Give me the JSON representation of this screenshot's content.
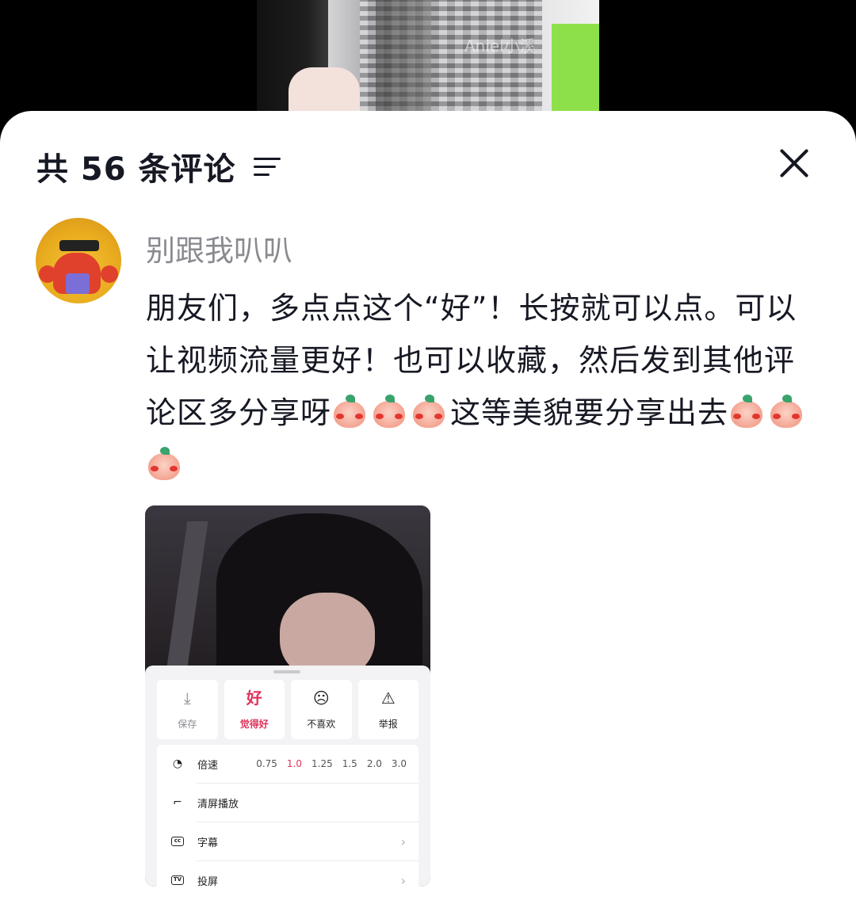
{
  "video": {
    "watermark": "Aniel小溪"
  },
  "header": {
    "title": "共 56 条评论"
  },
  "comment": {
    "username": "别跟我叭叭",
    "text_1": "朋友们，多点点这个“好”！长按就可以点。可以让视频流量更好！也可以收藏，然后发到其他评论区多分享呀",
    "text_2": "这等美貌要分享出去",
    "emoji_name": "blushing-peach-emoji"
  },
  "attachment": {
    "actions": [
      {
        "label": "保存",
        "icon": "download-icon"
      },
      {
        "label": "觉得好",
        "icon": "good-icon",
        "glyph": "好"
      },
      {
        "label": "不喜欢",
        "icon": "dislike-face-icon"
      },
      {
        "label": "举报",
        "icon": "warning-icon"
      }
    ],
    "settings": {
      "speed_label": "倍速",
      "speeds": [
        "0.75",
        "1.0",
        "1.25",
        "1.5",
        "2.0",
        "3.0"
      ],
      "active_speed": "1.0",
      "clear_screen_label": "清屏播放",
      "subtitles_label": "字幕",
      "cast_label": "投屏"
    }
  },
  "colors": {
    "accent": "#e0325a",
    "text": "#161823",
    "muted": "#8a8b91"
  }
}
